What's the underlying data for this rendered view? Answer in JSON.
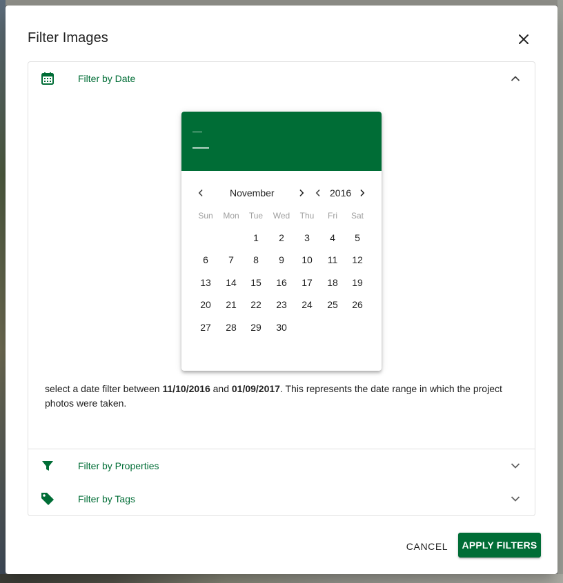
{
  "dialog": {
    "title": "Filter Images",
    "cancel_label": "CANCEL",
    "apply_label": "APPLY FILTERS"
  },
  "panels": [
    {
      "label": "Filter by Date",
      "icon": "calendar-icon",
      "expanded": true
    },
    {
      "label": "Filter by Properties",
      "icon": "filter-funnel-icon",
      "expanded": false
    },
    {
      "label": "Filter by Tags",
      "icon": "tag-icon",
      "expanded": false
    }
  ],
  "date_picker": {
    "header_year": "—",
    "header_date": "—",
    "month": "November",
    "year": "2016",
    "weekdays": [
      "Sun",
      "Mon",
      "Tue",
      "Wed",
      "Thu",
      "Fri",
      "Sat"
    ],
    "days": [
      "1",
      "2",
      "3",
      "4",
      "5",
      "6",
      "7",
      "8",
      "9",
      "10",
      "11",
      "12",
      "13",
      "14",
      "15",
      "16",
      "17",
      "18",
      "19",
      "20",
      "21",
      "22",
      "23",
      "24",
      "25",
      "26",
      "27",
      "28",
      "29",
      "30"
    ],
    "first_weekday_index": 2
  },
  "help": {
    "prefix": "select a date filter between ",
    "start_date": "11/10/2016",
    "middle": " and ",
    "end_date": "01/09/2017",
    "suffix": ". This represents the date range in which the project photos were taken."
  },
  "colors": {
    "accent": "#006d36",
    "text": "#212121",
    "muted": "#9e9e9e"
  }
}
